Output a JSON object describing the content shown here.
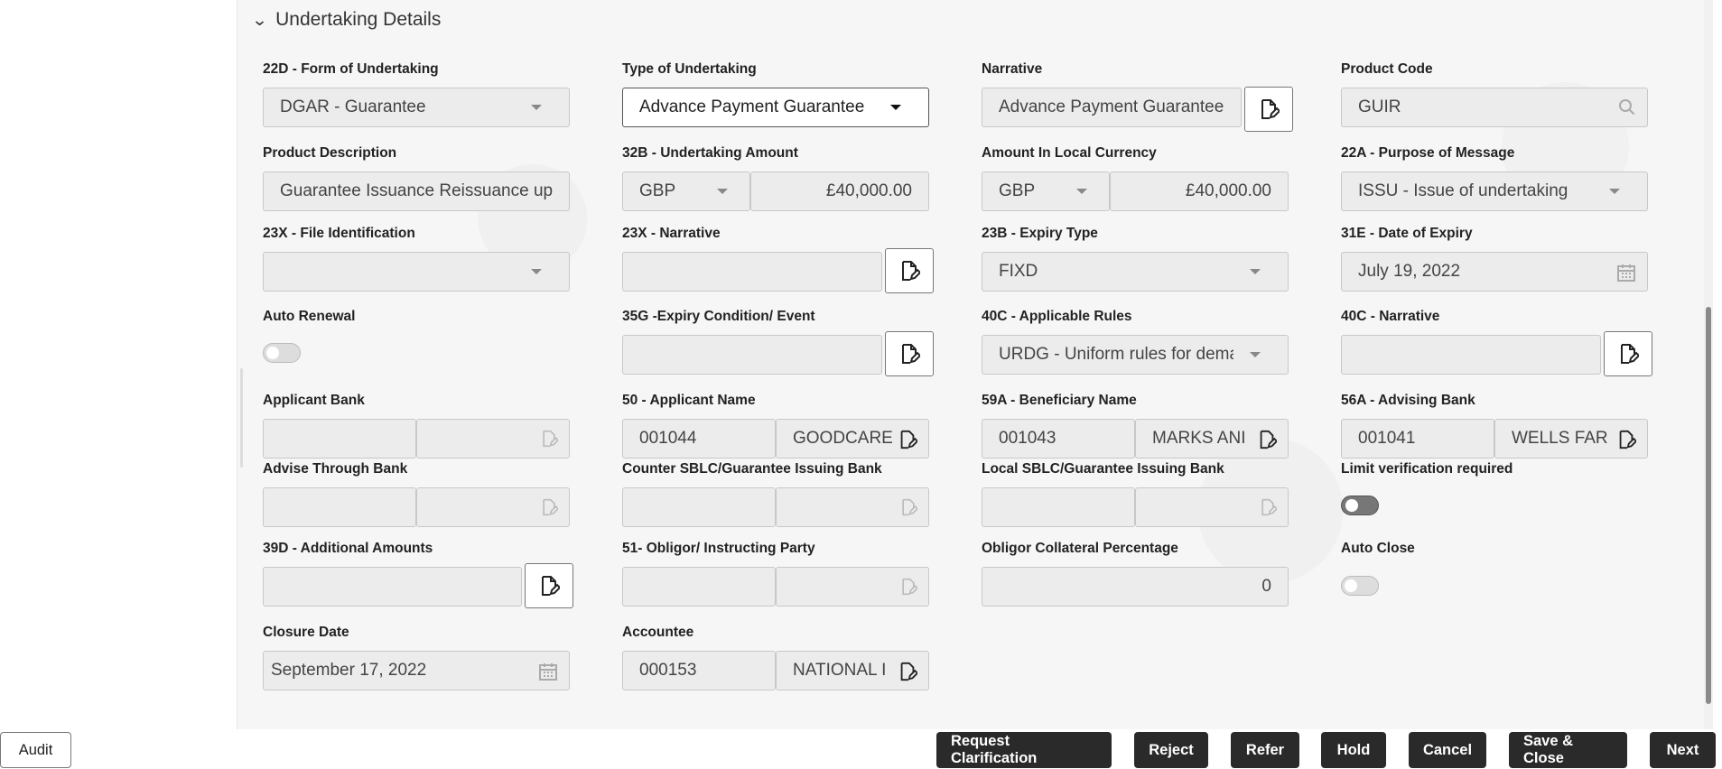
{
  "section": {
    "title": "Undertaking Details"
  },
  "fields": {
    "form_of_undertaking": {
      "label": "22D - Form of Undertaking",
      "value": "DGAR - Guarantee"
    },
    "type_of_undertaking": {
      "label": "Type of Undertaking",
      "value": "Advance Payment Guarantee"
    },
    "narrative": {
      "label": "Narrative",
      "value": "Advance Payment Guarantee"
    },
    "product_code": {
      "label": "Product Code",
      "value": "GUIR"
    },
    "product_description": {
      "label": "Product Description",
      "value": "Guarantee Issuance  Reissuance up"
    },
    "undertaking_amount": {
      "label": "32B - Undertaking Amount",
      "currency": "GBP",
      "value": "£40,000.00"
    },
    "amount_local_currency": {
      "label": "Amount In Local Currency",
      "currency": "GBP",
      "value": "£40,000.00"
    },
    "purpose_of_message": {
      "label": "22A - Purpose of Message",
      "value": "ISSU - Issue of undertaking"
    },
    "file_identification": {
      "label": "23X - File Identification",
      "value": ""
    },
    "narrative_23x": {
      "label": "23X - Narrative",
      "value": ""
    },
    "expiry_type": {
      "label": "23B - Expiry Type",
      "value": "FIXD"
    },
    "date_of_expiry": {
      "label": "31E - Date of Expiry",
      "value": "July 19, 2022"
    },
    "auto_renewal": {
      "label": "Auto Renewal"
    },
    "expiry_condition": {
      "label": "35G -Expiry Condition/ Event",
      "value": ""
    },
    "applicable_rules": {
      "label": "40C - Applicable Rules",
      "value": "URDG - Uniform rules for dema"
    },
    "narrative_40c": {
      "label": "40C - Narrative",
      "value": ""
    },
    "applicant_bank": {
      "label": "Applicant Bank",
      "id": "",
      "name": ""
    },
    "applicant_name": {
      "label": "50 - Applicant Name",
      "id": "001044",
      "name": "GOODCARE"
    },
    "beneficiary_name": {
      "label": "59A - Beneficiary Name",
      "id": "001043",
      "name": "MARKS ANI"
    },
    "advising_bank": {
      "label": "56A - Advising Bank",
      "id": "001041",
      "name": "WELLS FAR"
    },
    "advise_through_bank": {
      "label": "Advise Through Bank",
      "id": "",
      "name": ""
    },
    "counter_sblc": {
      "label": "Counter SBLC/Guarantee Issuing Bank",
      "id": "",
      "name": ""
    },
    "local_sblc": {
      "label": "Local SBLC/Guarantee Issuing Bank",
      "id": "",
      "name": ""
    },
    "limit_verification": {
      "label": "Limit verification required"
    },
    "additional_amounts": {
      "label": "39D - Additional Amounts",
      "value": ""
    },
    "obligor": {
      "label": "51- Obligor/ Instructing Party",
      "id": "",
      "name": ""
    },
    "obligor_collateral": {
      "label": "Obligor Collateral Percentage",
      "value": "0"
    },
    "auto_close": {
      "label": "Auto Close"
    },
    "closure_date": {
      "label": "Closure Date",
      "value": "September 17, 2022"
    },
    "accountee": {
      "label": "Accountee",
      "id": "000153",
      "name": "NATIONAL I"
    }
  },
  "buttons": {
    "audit": "Audit",
    "request_clarification": "Request Clarification",
    "reject": "Reject",
    "refer": "Refer",
    "hold": "Hold",
    "cancel": "Cancel",
    "save_close": "Save & Close",
    "next": "Next"
  }
}
